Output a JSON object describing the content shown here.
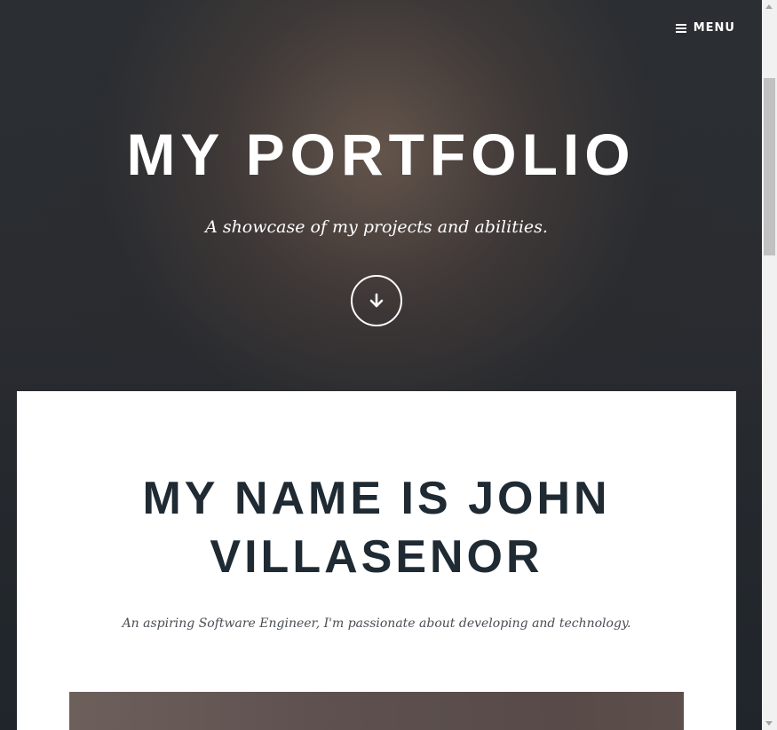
{
  "nav": {
    "menu_label": "MENU",
    "menu_icon": "hamburger-icon"
  },
  "hero": {
    "title": "MY PORTFOLIO",
    "subtitle": "A showcase of my projects and abilities.",
    "scroll_icon": "arrow-down-icon"
  },
  "about": {
    "heading": "MY NAME IS JOHN VILLASENOR",
    "tagline": "An aspiring Software Engineer, I'm passionate about developing and technology."
  },
  "scroll_position": 0.0
}
